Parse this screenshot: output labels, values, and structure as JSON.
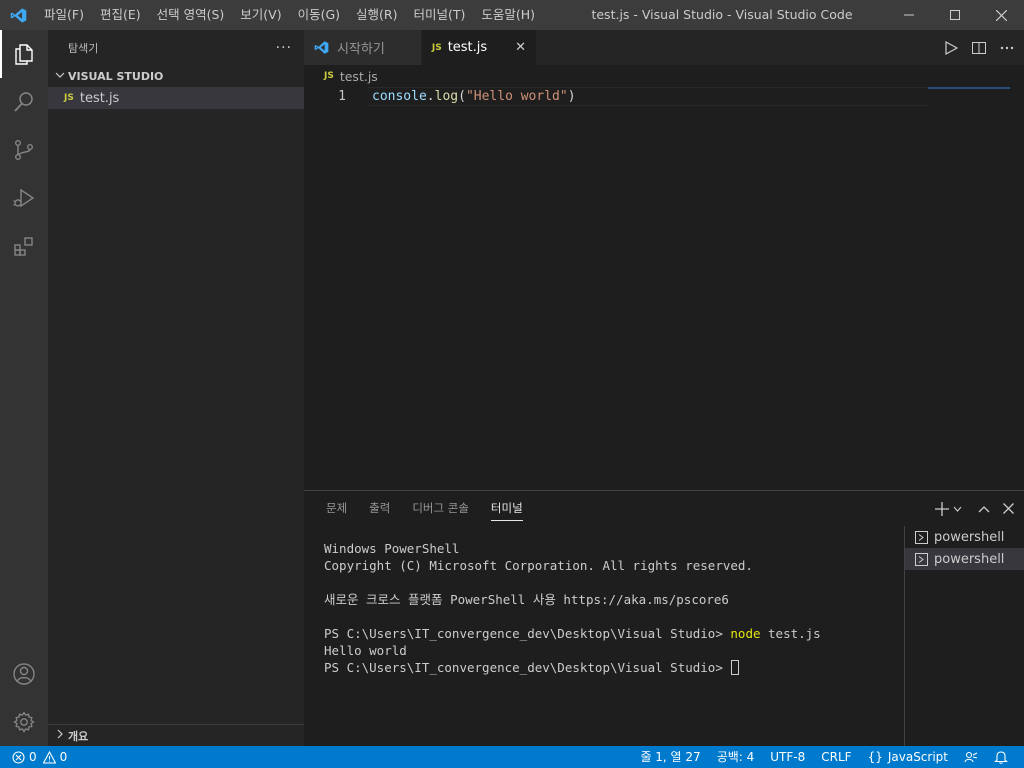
{
  "titlebar": {
    "menu": [
      "파일(F)",
      "편집(E)",
      "선택 영역(S)",
      "보기(V)",
      "이동(G)",
      "실행(R)",
      "터미널(T)",
      "도움말(H)"
    ],
    "title": "test.js - Visual Studio - Visual Studio Code"
  },
  "activitybar": {
    "items": [
      "explorer-icon",
      "search-icon",
      "source-control-icon",
      "run-debug-icon",
      "extensions-icon"
    ],
    "bottom": [
      "account-icon",
      "gear-icon"
    ]
  },
  "sidebar": {
    "title": "탐색기",
    "more": "···",
    "folder": "VISUAL STUDIO",
    "file_badge": "JS",
    "file": "test.js",
    "outline": "개요"
  },
  "tabs": [
    {
      "label": "시작하기",
      "icon": "vscode-icon",
      "active": false
    },
    {
      "label": "test.js",
      "icon_text": "JS",
      "active": true,
      "close": "✕"
    }
  ],
  "breadcrumb": {
    "badge": "JS",
    "file": "test.js"
  },
  "editor": {
    "lines": [
      {
        "number": "1",
        "tokens": [
          {
            "text": "console",
            "kind": "var"
          },
          {
            "text": ".",
            "kind": "punc"
          },
          {
            "text": "log",
            "kind": "fn"
          },
          {
            "text": "(",
            "kind": "punc"
          },
          {
            "text": "\"Hello world\"",
            "kind": "str"
          },
          {
            "text": ")",
            "kind": "punc"
          }
        ]
      }
    ]
  },
  "panel": {
    "tabs": [
      "문제",
      "출력",
      "디버그 콘솔",
      "터미널"
    ],
    "active_tab": "터미널",
    "terminal_lines": [
      {
        "text": "Windows PowerShell"
      },
      {
        "text": "Copyright (C) Microsoft Corporation. All rights reserved."
      },
      {
        "text": ""
      },
      {
        "text": "새로운 크로스 플랫폼 PowerShell 사용 https://aka.ms/pscore6"
      },
      {
        "text": ""
      },
      {
        "prompt": "PS C:\\Users\\IT_convergence_dev\\Desktop\\Visual Studio> ",
        "cmd": "node",
        "args": " test.js"
      },
      {
        "text": "Hello world"
      },
      {
        "prompt": "PS C:\\Users\\IT_convergence_dev\\Desktop\\Visual Studio> ",
        "cursor": true
      }
    ],
    "terminals": [
      "powershell",
      "powershell"
    ]
  },
  "statusbar": {
    "errors": "0",
    "warnings": "0",
    "position": "줄 1, 열 27",
    "spaces": "공백: 4",
    "encoding": "UTF-8",
    "eol": "CRLF",
    "language_braces": "{}",
    "language": "JavaScript"
  },
  "colors": {
    "accent": "#007acc",
    "js_badge": "#cbcb41",
    "vscode_blue": "#3ea8f5"
  }
}
